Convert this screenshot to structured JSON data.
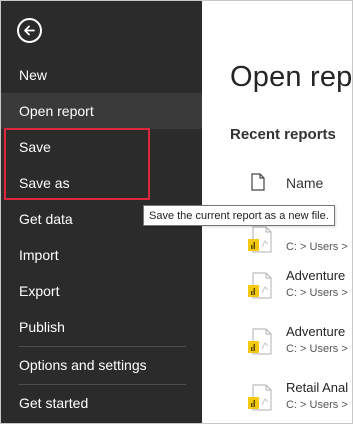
{
  "nav": {
    "back_icon": "back-arrow-icon",
    "items": [
      {
        "label": "New"
      },
      {
        "label": "Open report"
      },
      {
        "label": "Save"
      },
      {
        "label": "Save as"
      },
      {
        "label": "Get data"
      },
      {
        "label": "Import"
      },
      {
        "label": "Export"
      },
      {
        "label": "Publish"
      },
      {
        "label": "Options and settings"
      },
      {
        "label": "Get started"
      }
    ]
  },
  "main": {
    "title": "Open repo",
    "section": "Recent reports",
    "column_header": "Name",
    "files": [
      {
        "name": "",
        "path": "C: > Users >"
      },
      {
        "name": "Adventure",
        "path": "C: > Users >"
      },
      {
        "name": "Adventure",
        "path": "C: > Users >"
      },
      {
        "name": "Retail Anal",
        "path": "C: > Users >"
      }
    ]
  },
  "tooltip": "Save the current report as a new file.",
  "colors": {
    "nav_bg": "#2b2b2b",
    "nav_active": "#3a3a3a",
    "highlight": "#e0283c",
    "file_icon_yellow": "#f2c811"
  }
}
